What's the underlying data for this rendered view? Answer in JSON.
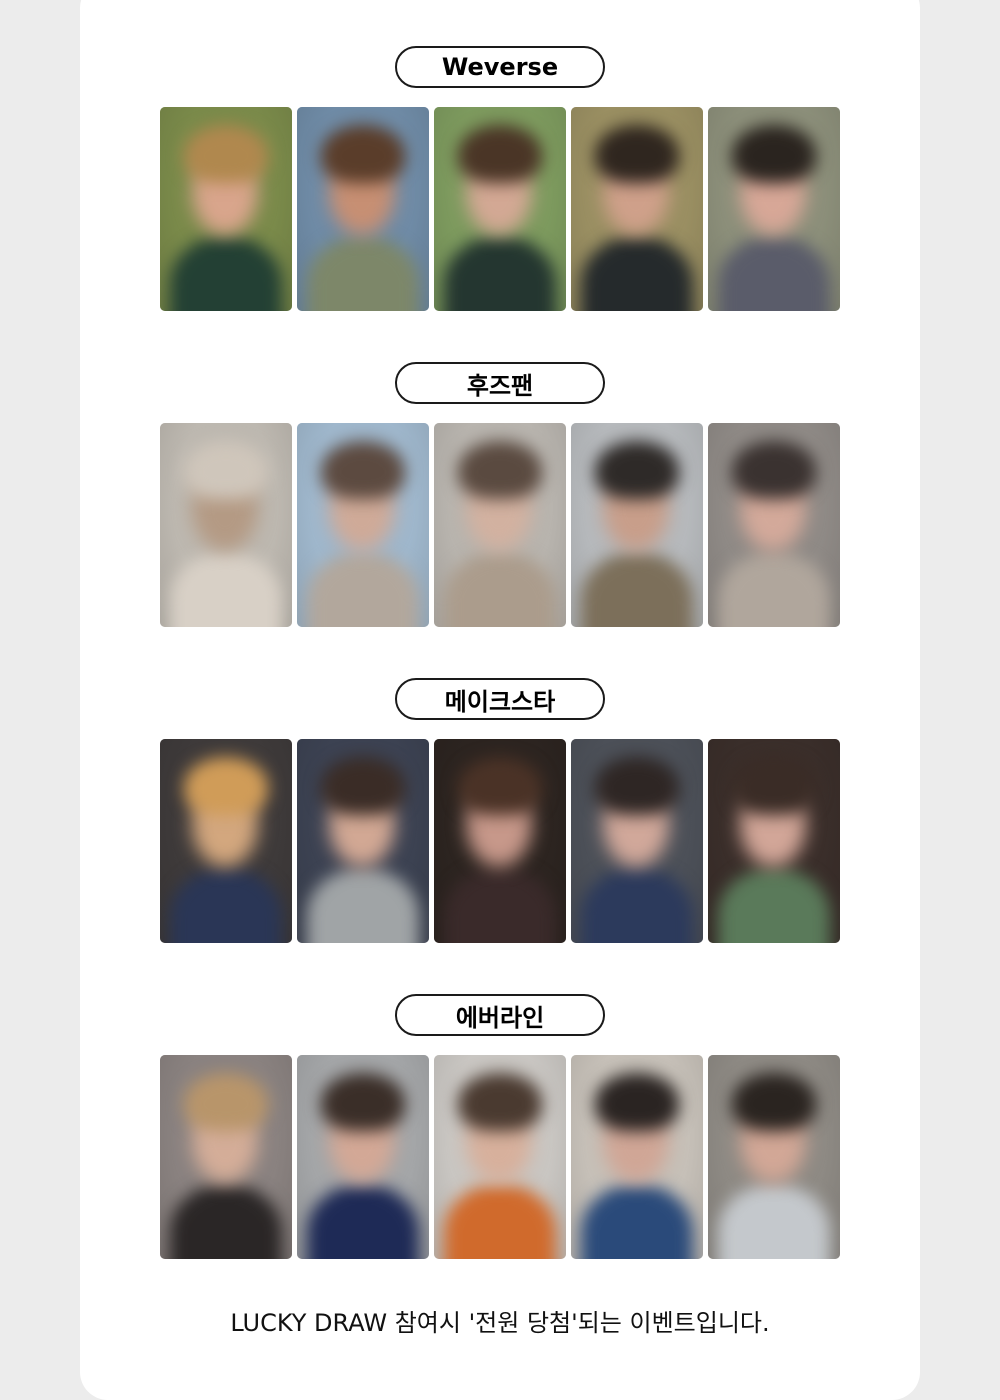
{
  "sections": [
    {
      "label": "Weverse",
      "photos": [
        {
          "bg": "#7a8a4a",
          "hair": "#b0884e",
          "face": "#d9a58c",
          "body": "#234034"
        },
        {
          "bg": "#6f8ba6",
          "hair": "#5a3d2a",
          "face": "#c78f73",
          "body": "#7d8769"
        },
        {
          "bg": "#7d9a5e",
          "hair": "#4a3526",
          "face": "#d3a894",
          "body": "#243630"
        },
        {
          "bg": "#9a8f62",
          "hair": "#2f261f",
          "face": "#cfa08a",
          "body": "#252a2c"
        },
        {
          "bg": "#8c8f7a",
          "hair": "#2a241f",
          "face": "#d7a797",
          "body": "#5a5c6a"
        }
      ]
    },
    {
      "label": "후즈팬",
      "photos": [
        {
          "bg": "#bdb8b0",
          "hair": "#cfc6bb",
          "face": "#b49a84",
          "body": "#d8d0c6"
        },
        {
          "bg": "#9fb7cc",
          "hair": "#5c4a40",
          "face": "#cfaa98",
          "body": "#b2a79c"
        },
        {
          "bg": "#b8b4ae",
          "hair": "#5a4a40",
          "face": "#d2b1a0",
          "body": "#ab9c8c"
        },
        {
          "bg": "#b6b9bc",
          "hair": "#2e2a28",
          "face": "#c89e8a",
          "body": "#7c6f5a"
        },
        {
          "bg": "#8f8a86",
          "hair": "#3a3230",
          "face": "#d3a99a",
          "body": "#b0a69c"
        }
      ]
    },
    {
      "label": "메이크스타",
      "photos": [
        {
          "bg": "#3e3a3a",
          "hair": "#d09c58",
          "face": "#d3a77e",
          "body": "#2a3656"
        },
        {
          "bg": "#3c4252",
          "hair": "#3a2c26",
          "face": "#d2a894",
          "body": "#a0a4a6"
        },
        {
          "bg": "#2c2420",
          "hair": "#4a3226",
          "face": "#c7988a",
          "body": "#3a2a2a"
        },
        {
          "bg": "#4c5058",
          "hair": "#2e2624",
          "face": "#d1a89a",
          "body": "#2c3a5c"
        },
        {
          "bg": "#3a2e2a",
          "hair": "#3a2c26",
          "face": "#d2a698",
          "body": "#5a7a5a"
        }
      ]
    },
    {
      "label": "에버라인",
      "photos": [
        {
          "bg": "#8a8280",
          "hair": "#b8956a",
          "face": "#d4ad98",
          "body": "#2a2626"
        },
        {
          "bg": "#a4a6a8",
          "hair": "#3a2e28",
          "face": "#d3a896",
          "body": "#1e2a56"
        },
        {
          "bg": "#c9c6c2",
          "hair": "#4a3a30",
          "face": "#d7b09c",
          "body": "#d06a2c"
        },
        {
          "bg": "#c6c0b8",
          "hair": "#2a2422",
          "face": "#d0a696",
          "body": "#2a4a7a"
        },
        {
          "bg": "#8e8a84",
          "hair": "#2a2420",
          "face": "#d2a796",
          "body": "#c4c8cc"
        }
      ]
    }
  ],
  "footer": {
    "text": "LUCKY DRAW 참여시 '전원 당첨'되는 이벤트입니다."
  }
}
